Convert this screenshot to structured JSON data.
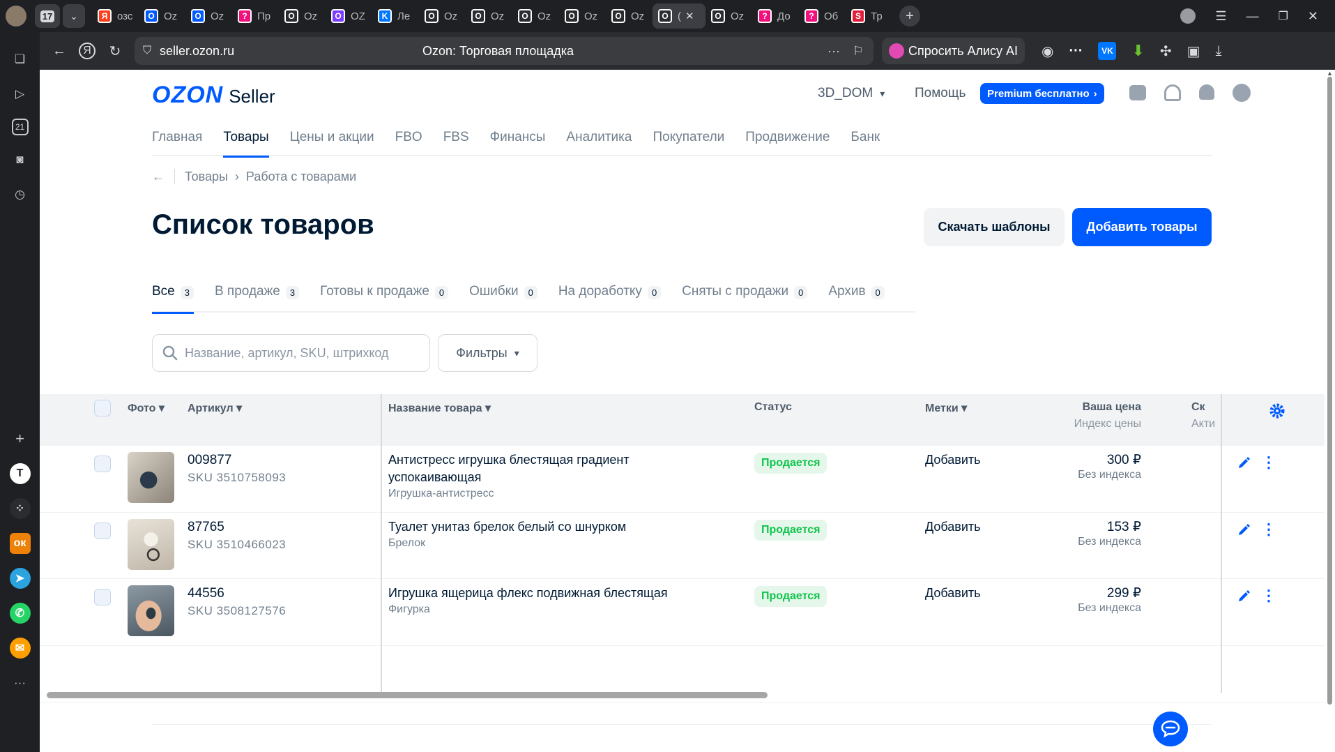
{
  "browser": {
    "tab_count": "17",
    "tabs": [
      {
        "label": "озс",
        "color": "#fc3f1d",
        "glyph": "Я"
      },
      {
        "label": "Oz",
        "color": "#005bff",
        "glyph": "O"
      },
      {
        "label": "Oz",
        "color": "#005bff",
        "glyph": "O"
      },
      {
        "label": "Пр",
        "color": "#f1117e",
        "glyph": "?"
      },
      {
        "label": "Oz",
        "color": "#2b2c30",
        "glyph": "O"
      },
      {
        "label": "OZ",
        "color": "#7a3cff",
        "glyph": "O"
      },
      {
        "label": "Ле",
        "color": "#0077ff",
        "glyph": "K"
      },
      {
        "label": "Oz",
        "color": "#2b2c30",
        "glyph": "O"
      },
      {
        "label": "Oz",
        "color": "#2b2c30",
        "glyph": "O"
      },
      {
        "label": "Oz",
        "color": "#2b2c30",
        "glyph": "O"
      },
      {
        "label": "Oz",
        "color": "#2b2c30",
        "glyph": "O"
      },
      {
        "label": "Oz",
        "color": "#2b2c30",
        "glyph": "O"
      },
      {
        "label": "(",
        "color": "#2b2c30",
        "glyph": "O",
        "active": true
      },
      {
        "label": "Oz",
        "color": "#2b2c30",
        "glyph": "O"
      },
      {
        "label": "До",
        "color": "#f1117e",
        "glyph": "?"
      },
      {
        "label": "Об",
        "color": "#f1117e",
        "glyph": "?"
      },
      {
        "label": "Тр",
        "color": "#e0203a",
        "glyph": "S"
      }
    ],
    "url": "seller.ozon.ru",
    "page_title": "Ozon: Торговая площадка",
    "alice_label": "Спросить Алису AI"
  },
  "header": {
    "logo_brand": "OZON",
    "logo_seller": "Seller",
    "shop_name": "3D_DOM",
    "help": "Помощь",
    "premium": "Premium бесплатно"
  },
  "nav": {
    "items": [
      "Главная",
      "Товары",
      "Цены и акции",
      "FBO",
      "FBS",
      "Финансы",
      "Аналитика",
      "Покупатели",
      "Продвижение",
      "Банк"
    ],
    "active_index": 1
  },
  "breadcrumb": {
    "back": "←",
    "item1": "Товары",
    "item2": "Работа с товарами"
  },
  "page": {
    "title": "Список товаров",
    "download_templates": "Скачать шаблоны",
    "add_products": "Добавить товары"
  },
  "status_tabs": [
    {
      "label": "Все",
      "count": "3",
      "active": true
    },
    {
      "label": "В продаже",
      "count": "3"
    },
    {
      "label": "Готовы к продаже",
      "count": "0"
    },
    {
      "label": "Ошибки",
      "count": "0"
    },
    {
      "label": "На доработку",
      "count": "0"
    },
    {
      "label": "Сняты с продажи",
      "count": "0"
    },
    {
      "label": "Архив",
      "count": "0"
    }
  ],
  "search": {
    "placeholder": "Название, артикул, SKU, штрихкод"
  },
  "filters_label": "Фильтры",
  "table": {
    "columns": {
      "photo": "Фото",
      "article": "Артикул",
      "name": "Название товара",
      "status": "Статус",
      "tags": "Метки",
      "price": "Ваша цена",
      "price_sub": "Индекс цены",
      "next": "Ск",
      "next_sub": "Акти"
    },
    "rows": [
      {
        "article": "009877",
        "sku": "SKU 3510758093",
        "name": "Антистресс игрушка блестящая градиент успокаивающая",
        "category": "Игрушка-антистресс",
        "status": "Продается",
        "tags": "Добавить",
        "price": "300 ₽",
        "price_index": "Без индекса"
      },
      {
        "article": "87765",
        "sku": "SKU 3510466023",
        "name": "Туалет унитаз брелок белый со шнурком",
        "category": "Брелок",
        "status": "Продается",
        "tags": "Добавить",
        "price": "153 ₽",
        "price_index": "Без индекса"
      },
      {
        "article": "44556",
        "sku": "SKU 3508127576",
        "name": "Игрушка ящерица флекс подвижная блестящая",
        "category": "Фигурка",
        "status": "Продается",
        "tags": "Добавить",
        "price": "299 ₽",
        "price_index": "Без индекса"
      }
    ]
  },
  "colors": {
    "accent": "#005bff",
    "success": "#10c44c",
    "success_bg": "#e5f7ea"
  }
}
